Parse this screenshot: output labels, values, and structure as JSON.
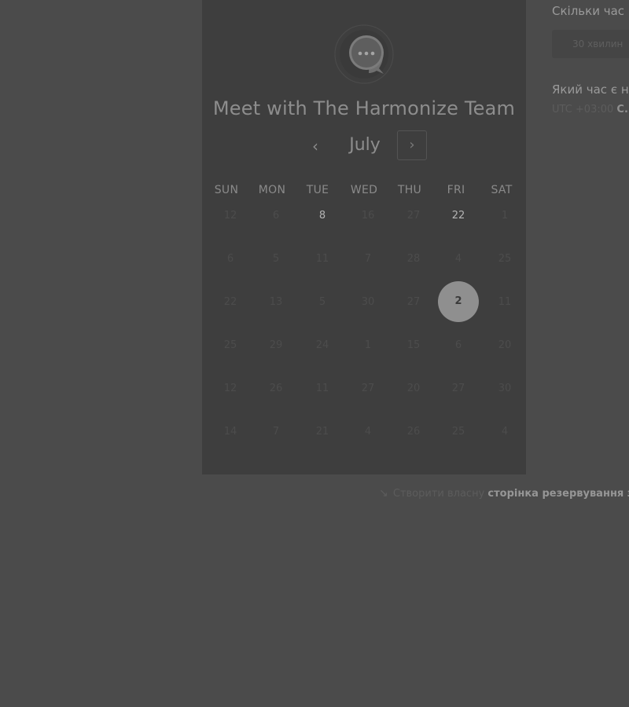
{
  "header": {
    "title": "Meet with The Harmonize Team",
    "logo_icon": "chat-bubble-icon"
  },
  "calendar": {
    "month": "July",
    "prev_icon": "chevron-left-icon",
    "next_icon": "chevron-right-icon",
    "weekdays": [
      "SUN",
      "MON",
      "TUE",
      "WED",
      "THU",
      "FRI",
      "SAT"
    ],
    "weeks": [
      [
        "12",
        "6",
        "8",
        "16",
        "27",
        "22",
        "1"
      ],
      [
        "6",
        "5",
        "11",
        "7",
        "28",
        "4",
        "25"
      ],
      [
        "22",
        "13",
        "5",
        "30",
        "27",
        "2",
        "11"
      ],
      [
        "25",
        "29",
        "24",
        "1",
        "15",
        "6",
        "20"
      ],
      [
        "12",
        "26",
        "11",
        "27",
        "20",
        "27",
        "30"
      ],
      [
        "14",
        "7",
        "21",
        "4",
        "26",
        "25",
        "4"
      ]
    ],
    "selected_day": "2"
  },
  "sidebar": {
    "duration_label": "Скільки час",
    "duration_value": "30 хвилин",
    "time_label": "Який час є н",
    "timezone": "UTC +03:00",
    "timezone_more": "С..."
  },
  "footer": {
    "icon": "arrow-icon",
    "lead": "Створити власну",
    "link": "сторінка резервування зу"
  },
  "colors": {
    "background": "#4b4b4b",
    "panel": "#3e3e3e",
    "selected": "#8f8f8f"
  }
}
